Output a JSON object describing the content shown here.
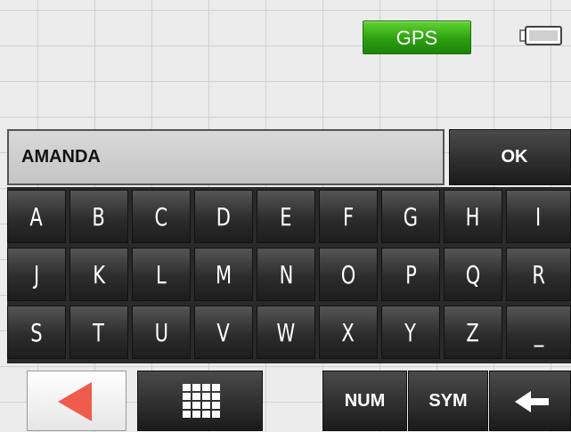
{
  "status": {
    "gps_label": "GPS",
    "battery_icon": "battery-icon",
    "gps_color": "#2da011"
  },
  "input": {
    "value": "AMANDA",
    "ok_label": "OK"
  },
  "keyboard": {
    "rows": [
      [
        "A",
        "B",
        "C",
        "D",
        "E",
        "F",
        "G",
        "H",
        "I"
      ],
      [
        "J",
        "K",
        "L",
        "M",
        "N",
        "O",
        "P",
        "Q",
        "R"
      ],
      [
        "S",
        "T",
        "U",
        "V",
        "W",
        "X",
        "Y",
        "Z",
        "_"
      ]
    ]
  },
  "bottom_bar": {
    "back_icon": "left-arrow-icon",
    "back_color": "#ef5b4c",
    "grid_icon": "grid-icon",
    "num_label": "NUM",
    "sym_label": "SYM",
    "backspace_icon": "backspace-arrow-icon"
  }
}
